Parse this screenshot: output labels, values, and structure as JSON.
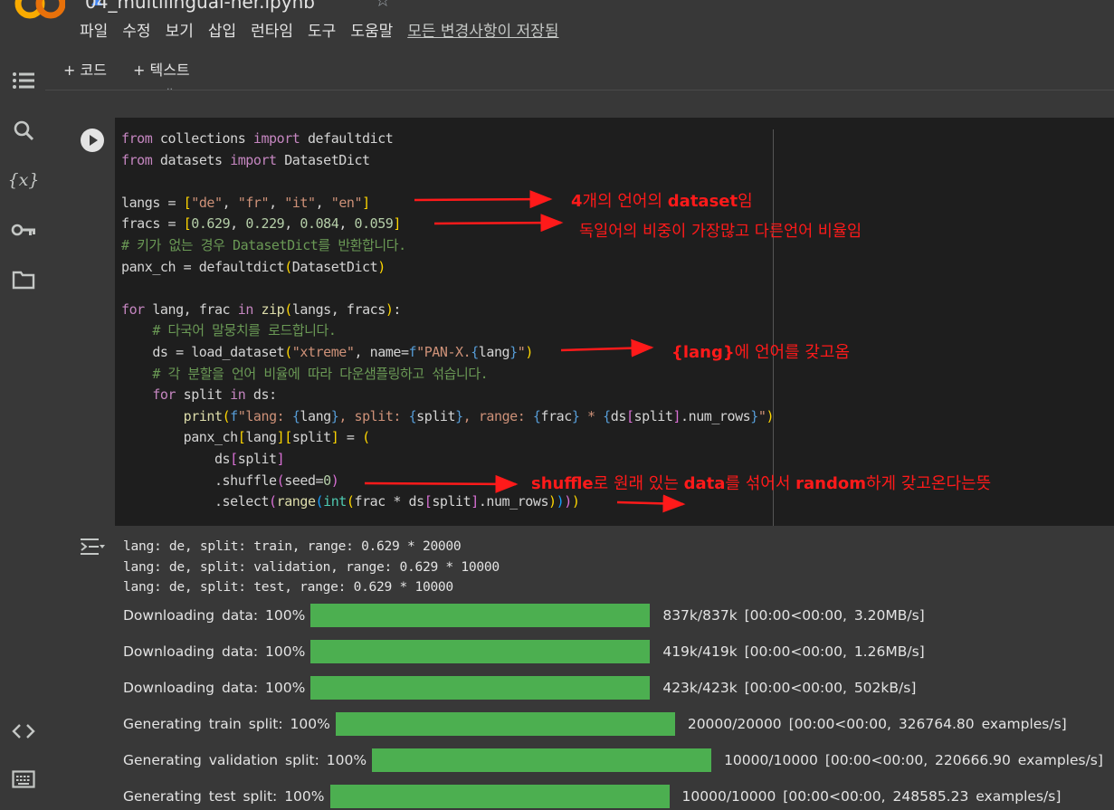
{
  "header": {
    "notebook_title": "04_multilingual-ner.ipynb",
    "menu": [
      "파일",
      "수정",
      "보기",
      "삽입",
      "런타임",
      "도구",
      "도움말"
    ],
    "save_status": "모든 변경사항이 저장됨"
  },
  "toolbar": {
    "add_code": "+ 코드",
    "add_text": "+ 텍스트"
  },
  "sidebar": {
    "icons": [
      "table-of-contents-icon",
      "search-icon",
      "variables-icon",
      "secrets-key-icon",
      "files-folder-icon",
      "code-snippets-icon",
      "terminal-icon"
    ]
  },
  "annotations": {
    "a1_bold": "4",
    "a1_mid": "개의 언어의 ",
    "a1_bold2": "dataset",
    "a1_end": "임",
    "a2": "독일어의 비중이 가장많고 다른언어 비율임",
    "a3_bold": "{lang}",
    "a3_end": "에 언어를 갖고옴",
    "a4_bold": "shuffle",
    "a4_mid": "로 원래 있는 ",
    "a4_bold2": "data",
    "a4_mid2": "를 섞어서 ",
    "a4_bold3": "random",
    "a4_end": "하게 갖고온다는뜻"
  },
  "output": {
    "log_lines": [
      "lang: de, split: train, range: 0.629 * 20000",
      "lang: de, split: validation, range: 0.629 * 10000",
      "lang: de, split: test, range: 0.629 * 10000"
    ],
    "progress": [
      {
        "label": "Downloading data: 100%",
        "fraction": 1.0,
        "stats": "837k/837k [00:00<00:00, 3.20MB/s]"
      },
      {
        "label": "Downloading data: 100%",
        "fraction": 1.0,
        "stats": "419k/419k [00:00<00:00, 1.26MB/s]"
      },
      {
        "label": "Downloading data: 100%",
        "fraction": 1.0,
        "stats": "423k/423k [00:00<00:00, 502kB/s]"
      },
      {
        "label": "Generating train split: 100%",
        "fraction": 1.0,
        "stats": "20000/20000 [00:00<00:00, 326764.80 examples/s]"
      },
      {
        "label": "Generating validation split: 100%",
        "fraction": 1.0,
        "stats": "10000/10000 [00:00<00:00, 220666.90 examples/s]"
      },
      {
        "label": "Generating test split: 100%",
        "fraction": 1.0,
        "stats": "10000/10000 [00:00<00:00, 248585.23 examples/s]"
      }
    ]
  },
  "colors": {
    "background": "#383838",
    "editor": "#1e1e1e",
    "progress_fill": "#4caf50",
    "annotation": "#ff1a1a"
  }
}
